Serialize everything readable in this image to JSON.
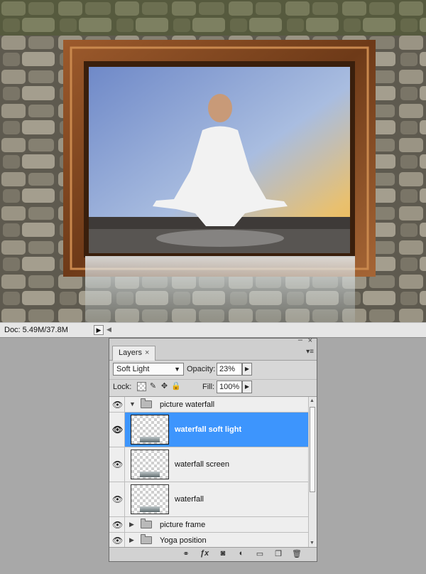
{
  "status_bar": {
    "doc_info": "Doc: 5.49M/37.8M"
  },
  "panel": {
    "tab_label": "Layers",
    "blend_mode": "Soft Light",
    "opacity_label": "Opacity:",
    "opacity_value": "23%",
    "lock_label": "Lock:",
    "fill_label": "Fill:",
    "fill_value": "100%",
    "layers": [
      {
        "name": "picture waterfall",
        "type": "group",
        "expanded": true
      },
      {
        "name": "waterfall soft light",
        "type": "layer",
        "selected": true
      },
      {
        "name": "waterfall screen",
        "type": "layer"
      },
      {
        "name": "waterfall",
        "type": "layer"
      },
      {
        "name": "picture frame",
        "type": "group",
        "expanded": false
      },
      {
        "name": "Yoga position",
        "type": "group",
        "expanded": false
      }
    ]
  },
  "colors": {
    "selection": "#3d95fd",
    "panel_bg": "#d7d7d7",
    "frame": "#8a4b22"
  },
  "icons": [
    "eye-icon",
    "folder-icon",
    "link-icon",
    "fx-icon",
    "mask-icon",
    "adjustment-icon",
    "new-group-icon",
    "new-layer-icon",
    "trash-icon",
    "panel-menu-icon",
    "lock-transparency-icon",
    "lock-brush-icon",
    "lock-move-icon",
    "lock-all-icon"
  ]
}
